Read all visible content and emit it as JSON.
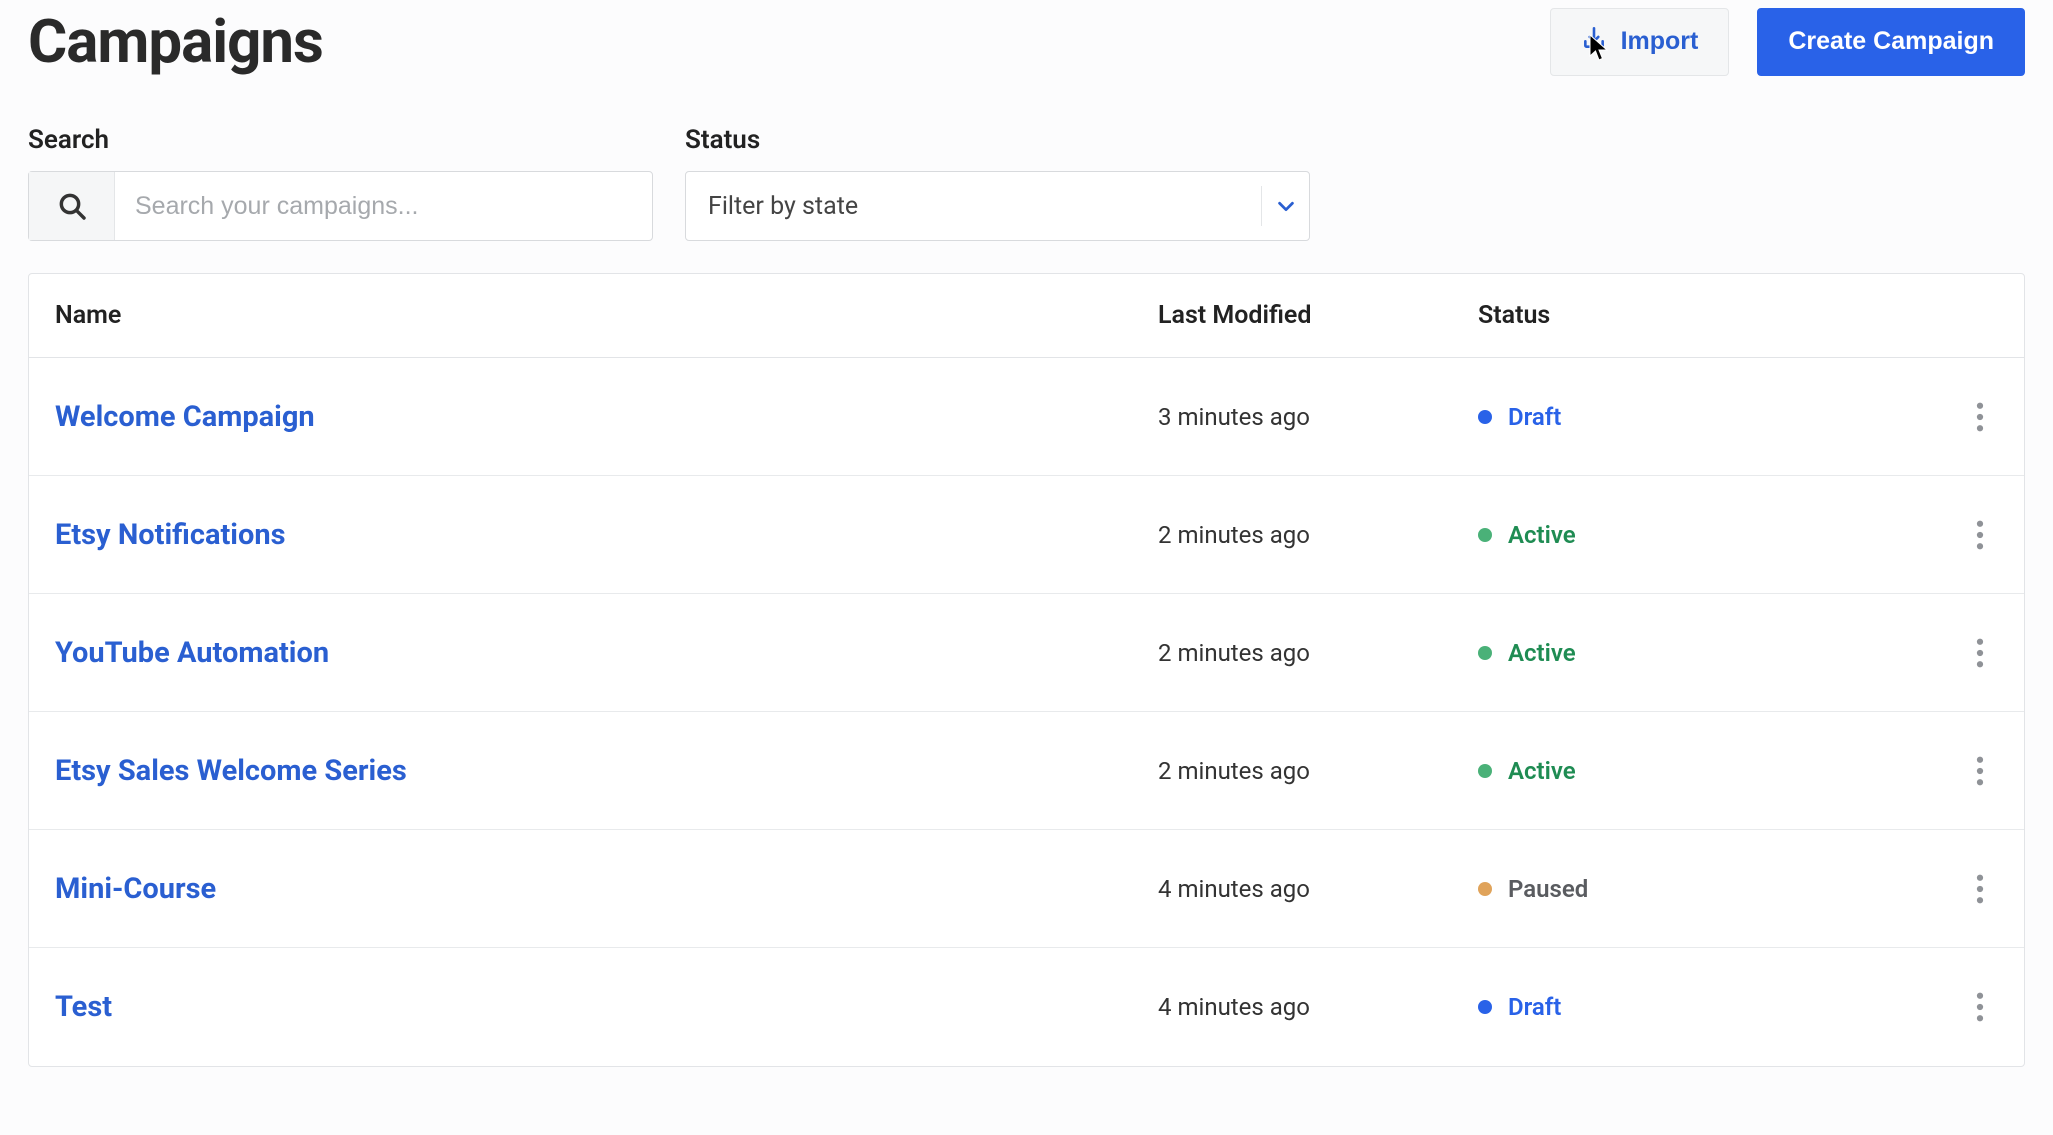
{
  "header": {
    "title": "Campaigns",
    "import_label": "Import",
    "create_label": "Create Campaign"
  },
  "filters": {
    "search_label": "Search",
    "search_placeholder": "Search your campaigns...",
    "status_label": "Status",
    "status_value": "Filter by state"
  },
  "table": {
    "columns": {
      "name": "Name",
      "last_modified": "Last Modified",
      "status": "Status"
    },
    "rows": [
      {
        "name": "Welcome Campaign",
        "last_modified": "3 minutes ago",
        "status": "Draft",
        "status_kind": "draft"
      },
      {
        "name": "Etsy Notifications",
        "last_modified": "2 minutes ago",
        "status": "Active",
        "status_kind": "active"
      },
      {
        "name": "YouTube Automation",
        "last_modified": "2 minutes ago",
        "status": "Active",
        "status_kind": "active"
      },
      {
        "name": "Etsy Sales Welcome Series",
        "last_modified": "2 minutes ago",
        "status": "Active",
        "status_kind": "active"
      },
      {
        "name": "Mini-Course",
        "last_modified": "4 minutes ago",
        "status": "Paused",
        "status_kind": "paused"
      },
      {
        "name": "Test",
        "last_modified": "4 minutes ago",
        "status": "Draft",
        "status_kind": "draft"
      }
    ]
  }
}
